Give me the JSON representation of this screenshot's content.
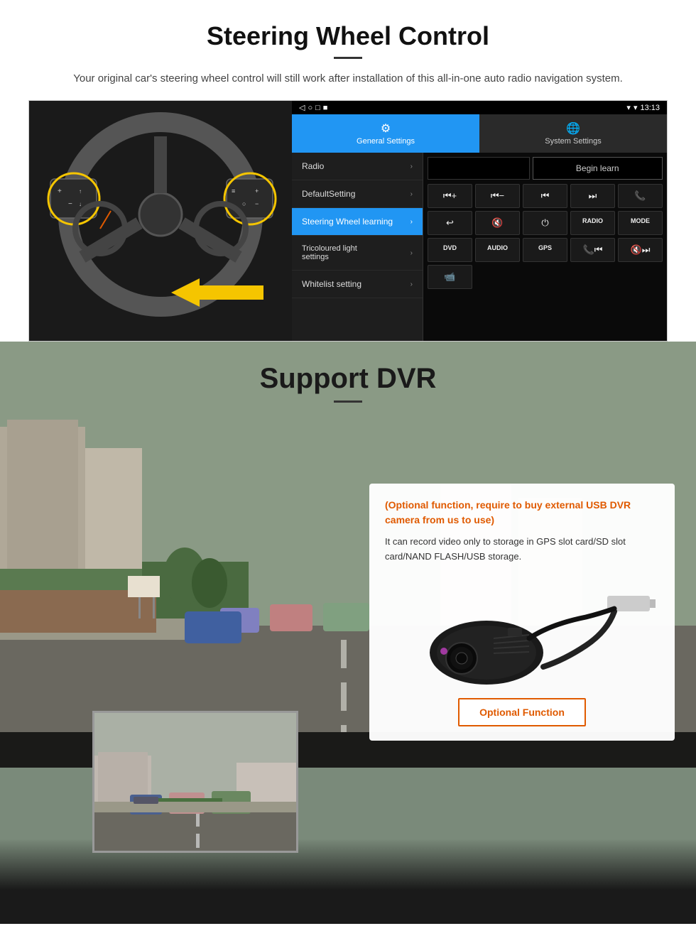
{
  "steering": {
    "title": "Steering Wheel Control",
    "subtitle": "Your original car's steering wheel control will still work after installation of this all-in-one auto radio navigation system.",
    "statusbar": {
      "time": "13:13",
      "signal": "▾",
      "wifi": "▾"
    },
    "tabs": [
      {
        "label": "General Settings",
        "icon": "⚙",
        "active": true
      },
      {
        "label": "System Settings",
        "icon": "🌐",
        "active": false
      }
    ],
    "menu_items": [
      {
        "label": "Radio",
        "active": false
      },
      {
        "label": "DefaultSetting",
        "active": false
      },
      {
        "label": "Steering Wheel learning",
        "active": true
      },
      {
        "label": "Tricoloured light settings",
        "active": false
      },
      {
        "label": "Whitelist setting",
        "active": false
      }
    ],
    "begin_learn": "Begin learn",
    "controls_row1": [
      "⏮+",
      "⏮−",
      "⏮",
      "⏭",
      "📞"
    ],
    "controls_row2": [
      "↩",
      "🔇x",
      "⏻",
      "RADIO",
      "MODE"
    ],
    "controls_row3": [
      "DVD",
      "AUDIO",
      "GPS",
      "📞⏮",
      "🔇⏭"
    ],
    "controls_row4_icon": "📹"
  },
  "dvr": {
    "title": "Support DVR",
    "optional_text": "(Optional function, require to buy external USB DVR camera from us to use)",
    "description": "It can record video only to storage in GPS slot card/SD slot card/NAND FLASH/USB storage.",
    "optional_btn": "Optional Function"
  }
}
